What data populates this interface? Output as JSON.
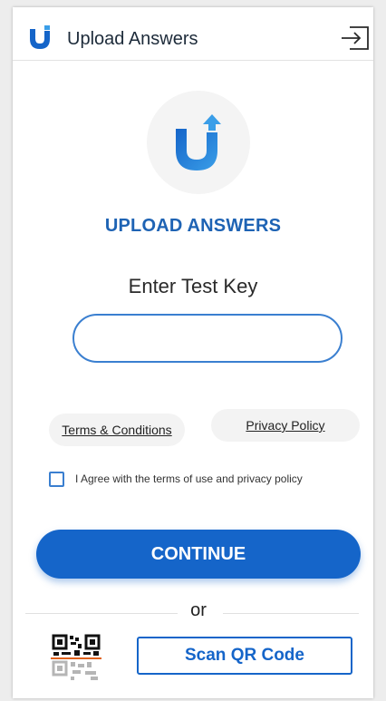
{
  "header": {
    "title": "Upload Answers",
    "logo_icon": "app-logo-u-icon",
    "logout_icon": "logout-icon"
  },
  "hero": {
    "logo_icon": "app-logo-u-arrow-icon",
    "app_name": "UPLOAD ANSWERS"
  },
  "form": {
    "label": "Enter Test Key",
    "input_value": "",
    "input_placeholder": "",
    "terms_label": "Terms & Conditions",
    "privacy_label": "Privacy Policy",
    "agree_label": "I Agree with the terms of use and privacy policy",
    "agree_checked": false,
    "continue_label": "CONTINUE"
  },
  "alt": {
    "or_label": "or",
    "qr_icon": "qr-code-icon",
    "scan_label": "Scan QR Code"
  },
  "colors": {
    "primary": "#1565c9",
    "accent_text": "#1e63b4",
    "input_border": "#3a7fd0"
  }
}
